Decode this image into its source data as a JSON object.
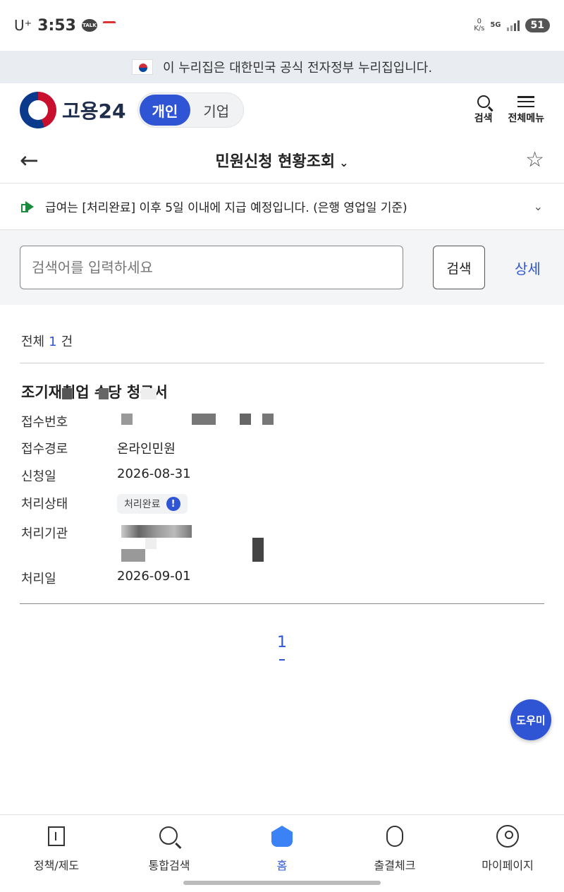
{
  "status_bar": {
    "carrier": "U⁺",
    "time": "3:53",
    "talk_badge": "TALK",
    "net_speed_value": "0",
    "net_speed_unit": "K/s",
    "network": "5G",
    "battery": "51"
  },
  "gov_banner": {
    "text": "이 누리집은 대한민국 공식 전자정부 누리집입니다."
  },
  "header": {
    "logo_text": "고용24",
    "segments": [
      {
        "label": "개인",
        "active": true
      },
      {
        "label": "기업",
        "active": false
      }
    ],
    "search_label": "검색",
    "menu_label": "전체메뉴"
  },
  "page": {
    "title": "민원신청 현황조회"
  },
  "notice": {
    "text": "급여는 [처리완료] 이후 5일 이내에 지급 예정입니다. (은행 영업일 기준)"
  },
  "search": {
    "placeholder": "검색어를 입력하세요",
    "value": "",
    "button_label": "검색",
    "detail_label": "상세"
  },
  "results": {
    "prefix": "전체",
    "count": "1",
    "suffix": "건"
  },
  "record": {
    "title": "조기재취업 수당 청구서",
    "fields": {
      "receipt_no": {
        "label": "접수번호",
        "value": ""
      },
      "route": {
        "label": "접수경로",
        "value": "온라인민원"
      },
      "apply_date": {
        "label": "신청일",
        "value": "2026-08-31"
      },
      "status": {
        "label": "처리상태",
        "value": "처리완료"
      },
      "agency": {
        "label": "처리기관",
        "value": ""
      },
      "done_date": {
        "label": "처리일",
        "value": "2026-09-01"
      }
    }
  },
  "pagination": {
    "current": "1"
  },
  "helper": {
    "label": "도우미"
  },
  "bottom_nav": [
    {
      "label": "정책/제도",
      "icon": "building-icon"
    },
    {
      "label": "통합검색",
      "icon": "search-icon"
    },
    {
      "label": "홈",
      "icon": "home-icon",
      "active": true
    },
    {
      "label": "출결체크",
      "icon": "lock-icon"
    },
    {
      "label": "마이페이지",
      "icon": "person-icon"
    }
  ],
  "colors": {
    "accent": "#2f55d4",
    "notice_icon": "#1a8a3c",
    "banner_bg": "#e9edf2"
  }
}
